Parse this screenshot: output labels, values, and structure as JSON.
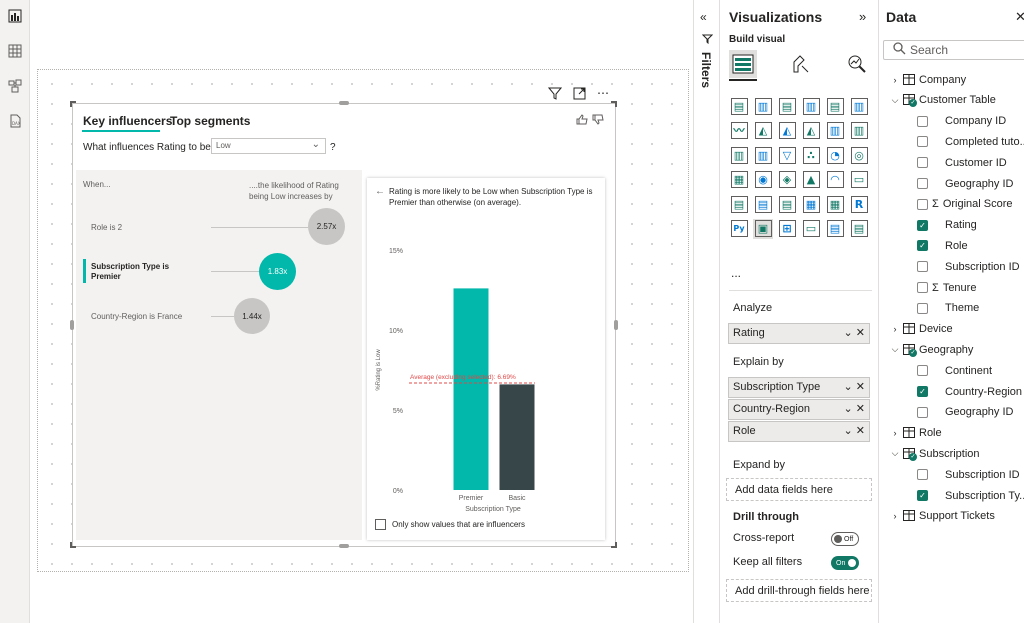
{
  "visual": {
    "tabs": [
      "Key influencers",
      "Top segments"
    ],
    "question_label": "What influences Rating to be",
    "question_value": "Low",
    "question_mark": "?",
    "when_head": "When...",
    "likelihood_head": "....the likelihood of Rating being Low increases by",
    "influencers": [
      {
        "label": "Role is 2",
        "value": "2.57x",
        "selected": false
      },
      {
        "label": "Subscription Type is Premier",
        "value": "1.83x",
        "selected": true
      },
      {
        "label": "Country-Region is France",
        "value": "1.44x",
        "selected": false
      }
    ],
    "detail_text": "Rating is more likely to be Low when Subscription Type is Premier than otherwise (on average).",
    "only_influencers_label": "Only show values that are influencers"
  },
  "chart_data": {
    "type": "bar",
    "categories": [
      "Premier",
      "Basic"
    ],
    "values": [
      12.6,
      6.6
    ],
    "colors": [
      "#01b8aa",
      "#374649"
    ],
    "ylabel": "%Rating is Low",
    "xlabel": "Subscription Type",
    "ylim": [
      0,
      15
    ],
    "yticks": [
      0,
      5,
      10,
      15
    ],
    "ytick_labels": [
      "0%",
      "5%",
      "10%",
      "15%"
    ],
    "average_line": {
      "value": 6.69,
      "label": "Average (excluding selected): 6.69%",
      "color": "#e04848"
    }
  },
  "filters": {
    "title": "Filters"
  },
  "visualizations": {
    "title": "Visualizations",
    "build_visual": "Build visual",
    "more": "...",
    "analyze_label": "Analyze",
    "analyze_fields": [
      "Rating"
    ],
    "explain_label": "Explain by",
    "explain_fields": [
      "Subscription Type",
      "Country-Region",
      "Role"
    ],
    "expand_label": "Expand by",
    "expand_placeholder": "Add data fields here",
    "drill_label": "Drill through",
    "cross_report_label": "Cross-report",
    "cross_report_state": "Off",
    "keep_filters_label": "Keep all filters",
    "keep_filters_state": "On",
    "drill_placeholder": "Add drill-through fields here"
  },
  "data": {
    "title": "Data",
    "search_placeholder": "Search",
    "tree": [
      {
        "kind": "table",
        "label": "Company",
        "expanded": false
      },
      {
        "kind": "table",
        "label": "Customer Table",
        "expanded": true,
        "used": true
      },
      {
        "kind": "field",
        "label": "Company ID",
        "checked": false
      },
      {
        "kind": "field",
        "label": "Completed tuto...",
        "checked": false
      },
      {
        "kind": "field",
        "label": "Customer ID",
        "checked": false
      },
      {
        "kind": "field",
        "label": "Geography ID",
        "checked": false
      },
      {
        "kind": "measure",
        "label": "Original Score",
        "checked": false
      },
      {
        "kind": "field",
        "label": "Rating",
        "checked": true
      },
      {
        "kind": "field",
        "label": "Role",
        "checked": true
      },
      {
        "kind": "field",
        "label": "Subscription ID",
        "checked": false
      },
      {
        "kind": "measure",
        "label": "Tenure",
        "checked": false
      },
      {
        "kind": "field",
        "label": "Theme",
        "checked": false
      },
      {
        "kind": "table",
        "label": "Device",
        "expanded": false
      },
      {
        "kind": "table",
        "label": "Geography",
        "expanded": true,
        "used": true
      },
      {
        "kind": "field",
        "label": "Continent",
        "checked": false
      },
      {
        "kind": "field",
        "label": "Country-Region",
        "checked": true
      },
      {
        "kind": "field",
        "label": "Geography ID",
        "checked": false
      },
      {
        "kind": "table",
        "label": "Role",
        "expanded": false
      },
      {
        "kind": "table",
        "label": "Subscription",
        "expanded": true,
        "used": true
      },
      {
        "kind": "field",
        "label": "Subscription ID",
        "checked": false
      },
      {
        "kind": "field",
        "label": "Subscription Ty...",
        "checked": true
      },
      {
        "kind": "table",
        "label": "Support Tickets",
        "expanded": false
      }
    ]
  },
  "colors": {
    "accent": "#01b8aa",
    "dark_bar": "#374649",
    "check": "#117865"
  }
}
